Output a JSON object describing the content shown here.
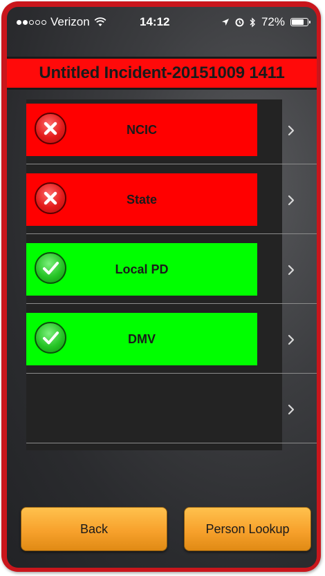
{
  "status_bar": {
    "carrier": "Verizon",
    "time": "14:12",
    "battery": "72%",
    "battery_level": 0.72,
    "signal_bars_filled": 2,
    "signal_bars_total": 5
  },
  "title": "Untitled Incident-20151009 1411",
  "checks": [
    {
      "label": "NCIC",
      "status": "fail",
      "color": "#ff0000"
    },
    {
      "label": "State",
      "status": "fail",
      "color": "#ff0000"
    },
    {
      "label": "Local PD",
      "status": "pass",
      "color": "#00ff00"
    },
    {
      "label": "DMV",
      "status": "pass",
      "color": "#00ff00"
    },
    {
      "label": "",
      "status": "empty",
      "color": "#232323"
    }
  ],
  "buttons": {
    "back": "Back",
    "person_lookup": "Person Lookup"
  },
  "colors": {
    "frame": "#c9161c",
    "title_bar": "#ff0a0a",
    "fail": "#ff0000",
    "pass": "#00ff00",
    "button": "#f7a12c"
  },
  "icons": {
    "fail": "x-circle-icon",
    "pass": "check-circle-icon",
    "row_nav": "chevron-right-icon"
  }
}
